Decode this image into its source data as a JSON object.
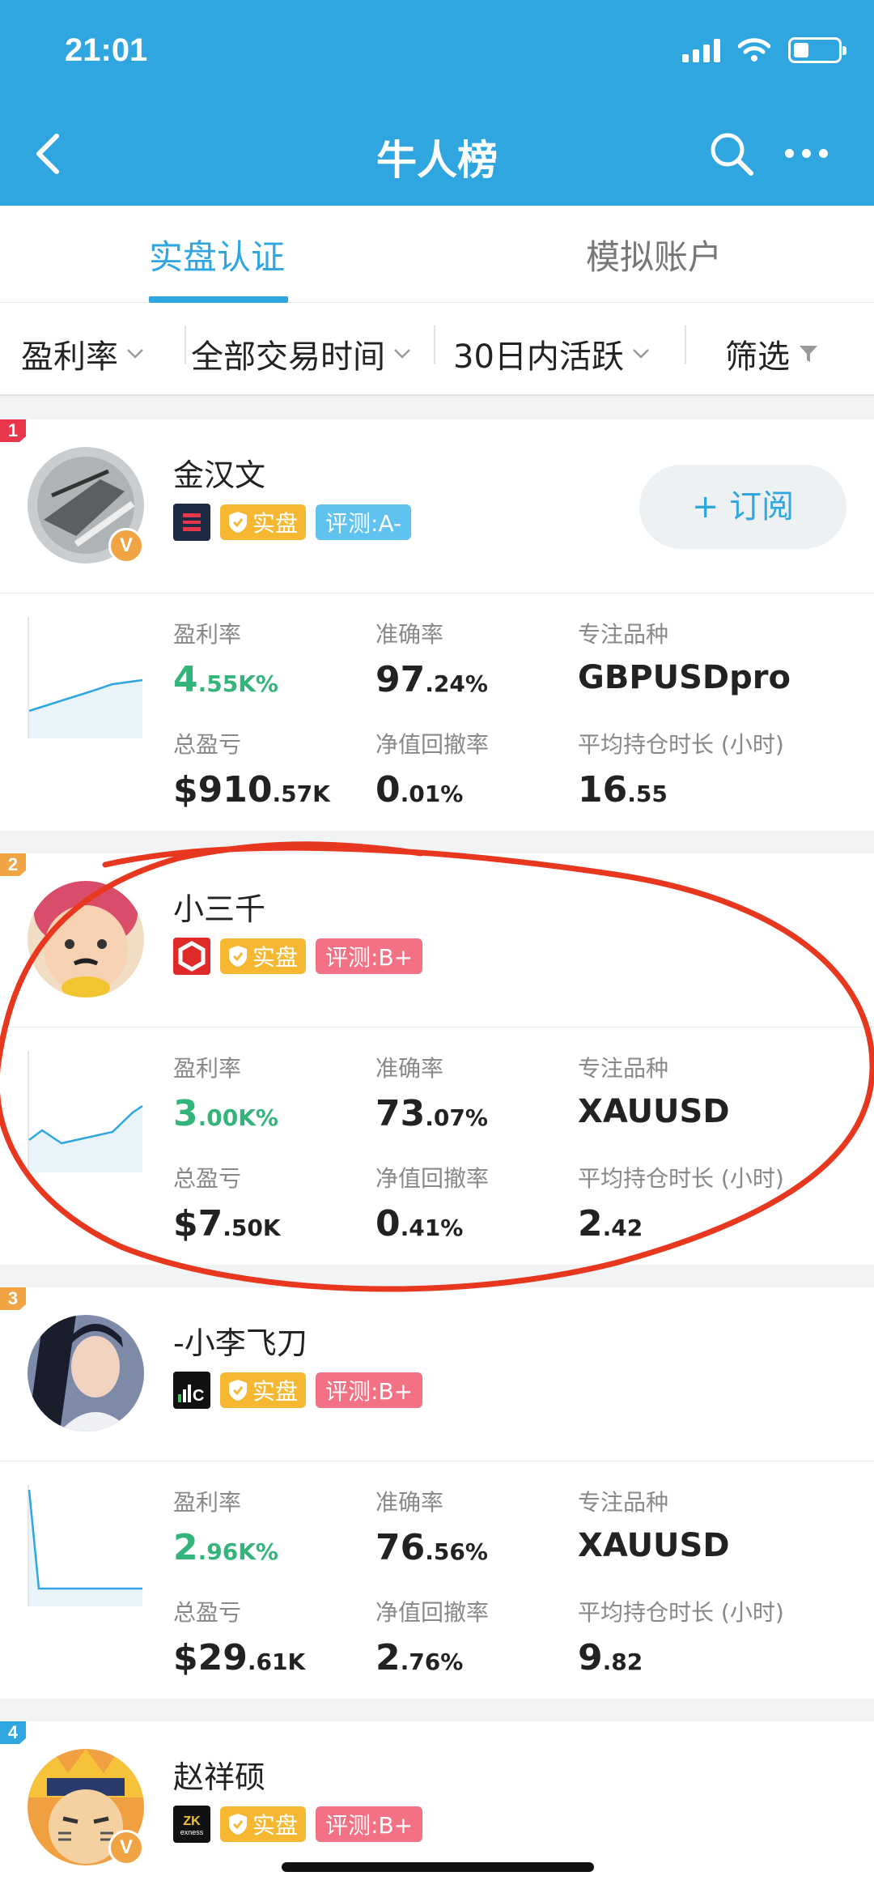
{
  "status": {
    "time": "21:01"
  },
  "nav": {
    "title": "牛人榜"
  },
  "tabs": [
    {
      "label": "实盘认证"
    },
    {
      "label": "模拟账户"
    }
  ],
  "filters": [
    {
      "label": "盈利率"
    },
    {
      "label": "全部交易时间"
    },
    {
      "label": "30日内活跃"
    },
    {
      "label": "筛选"
    }
  ],
  "labels": {
    "profit_rate": "盈利率",
    "accuracy": "准确率",
    "focus_symbol": "专注品种",
    "total_pnl": "总盈亏",
    "drawdown": "净值回撤率",
    "avg_hold": "平均持仓时长 (小时)",
    "real_tag": "实盘",
    "subscribe": "+ 订阅"
  },
  "traders": [
    {
      "rank": "1",
      "name": "金汉文",
      "rating": "评测:A-",
      "profit_int": "4",
      "profit_dec": ".55K%",
      "accuracy_int": "97",
      "accuracy_dec": ".24%",
      "symbol": "GBPUSDpro",
      "pnl_int": "$910",
      "pnl_dec": ".57K",
      "dd_int": "0",
      "dd_dec": ".01%",
      "hold_int": "16",
      "hold_dec": ".55",
      "colors": {
        "rating": "#5fc2ef"
      }
    },
    {
      "rank": "2",
      "name": "小三千",
      "rating": "评测:B+",
      "profit_int": "3",
      "profit_dec": ".00K%",
      "accuracy_int": "73",
      "accuracy_dec": ".07%",
      "symbol": "XAUUSD",
      "pnl_int": "$7",
      "pnl_dec": ".50K",
      "dd_int": "0",
      "dd_dec": ".41%",
      "hold_int": "2",
      "hold_dec": ".42",
      "colors": {
        "rating": "#f27185"
      }
    },
    {
      "rank": "3",
      "name": "-小李飞刀",
      "rating": "评测:B+",
      "profit_int": "2",
      "profit_dec": ".96K%",
      "accuracy_int": "76",
      "accuracy_dec": ".56%",
      "symbol": "XAUUSD",
      "pnl_int": "$29",
      "pnl_dec": ".61K",
      "dd_int": "2",
      "dd_dec": ".76%",
      "hold_int": "9",
      "hold_dec": ".82",
      "colors": {
        "rating": "#f27185"
      }
    },
    {
      "rank": "4",
      "name": "赵祥硕",
      "rating": "评测:B+",
      "colors": {
        "rating": "#f27185"
      }
    }
  ],
  "colors": {
    "brand": "#2fa6e0",
    "profit_green": "#33b47a",
    "real_tag": "#f6b733",
    "annotation": "#e8371f"
  }
}
